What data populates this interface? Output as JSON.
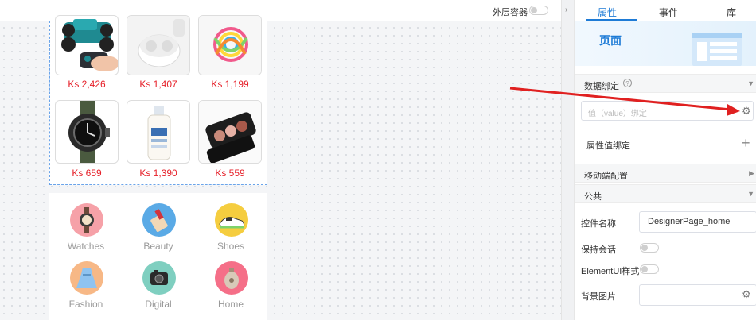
{
  "toolbar": {
    "outer_container_label": "外层容器",
    "outer_container_enabled": false
  },
  "products": [
    {
      "price": "Ks 2,426",
      "icon": "rc-car-icon"
    },
    {
      "price": "Ks 1,407",
      "icon": "earbuds-icon"
    },
    {
      "price": "Ks 1,199",
      "icon": "baby-toy-icon"
    },
    {
      "price": "Ks 659",
      "icon": "watch-icon"
    },
    {
      "price": "Ks 1,390",
      "icon": "lotion-icon"
    },
    {
      "price": "Ks 559",
      "icon": "makeup-palette-icon"
    }
  ],
  "categories": [
    {
      "label": "Watches",
      "color": "#f6a1a8"
    },
    {
      "label": "Beauty",
      "color": "#5aaae6"
    },
    {
      "label": "Shoes",
      "color": "#f5cd3f"
    },
    {
      "label": "Fashion",
      "color": "#f7b886"
    },
    {
      "label": "Digital",
      "color": "#7fcfc0"
    },
    {
      "label": "Home",
      "color": "#f56f88"
    }
  ],
  "panel": {
    "tabs": [
      "属性",
      "事件",
      "库"
    ],
    "active_tab": "属性",
    "page_title": "页面",
    "data_binding": {
      "title": "数据绑定",
      "value_placeholder": "值（value）绑定",
      "property_binding_label": "属性值绑定"
    },
    "mobile_config": "移动端配置",
    "common": {
      "title": "公共",
      "control_name_label": "控件名称",
      "control_name_value": "DesignerPage_home",
      "keep_session_label": "保持会话",
      "elementui_label": "ElementUI样式",
      "background_label": "背景图片"
    }
  },
  "colors": {
    "accent": "#1e7bd6",
    "price": "#e6212a",
    "annotation_arrow": "#e02020"
  }
}
